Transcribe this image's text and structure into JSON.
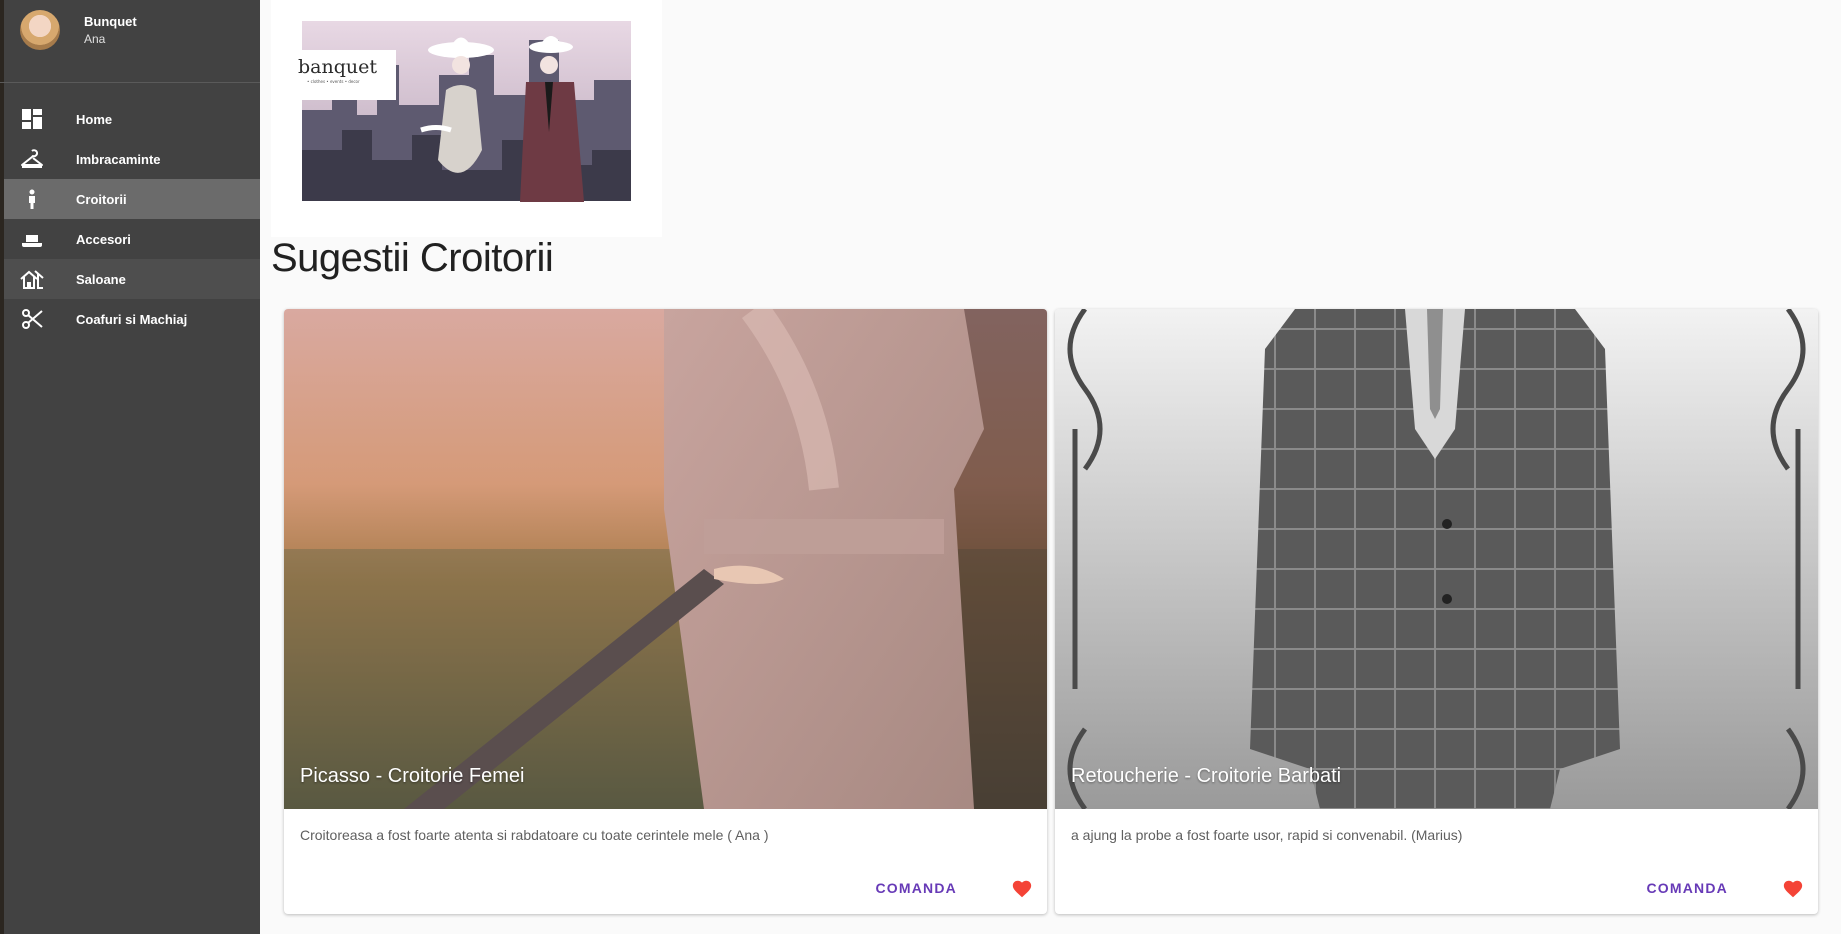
{
  "user": {
    "name": "Bunquet",
    "subtitle": "Ana"
  },
  "nav": [
    {
      "label": "Home",
      "icon": "dashboard-icon"
    },
    {
      "label": "Imbracaminte",
      "icon": "hanger-icon"
    },
    {
      "label": "Croitorii",
      "icon": "person-icon",
      "active": true
    },
    {
      "label": "Accesori",
      "icon": "hat-icon"
    },
    {
      "label": "Saloane",
      "icon": "house-icon"
    },
    {
      "label": "Coafuri si Machiaj",
      "icon": "scissors-icon"
    }
  ],
  "banner": {
    "logo_text": "banquet",
    "tagline": "• clothes   • events   • decor"
  },
  "page": {
    "title": "Sugestii Croitorii"
  },
  "cards": [
    {
      "title": "Picasso - Croitorie Femei",
      "text": "Croitoreasa a fost foarte atenta si rabdatoare cu toate cerintele mele ( Ana )",
      "action": "COMANDA"
    },
    {
      "title": "Retoucherie - Croitorie Barbati",
      "text": "a ajung la probe a fost foarte usor, rapid si convenabil. (Marius)",
      "action": "COMANDA"
    }
  ],
  "colors": {
    "sidebar": "#424242",
    "active_nav": "#6b6b6b",
    "accent": "#673ab7",
    "heart": "#f44336"
  }
}
